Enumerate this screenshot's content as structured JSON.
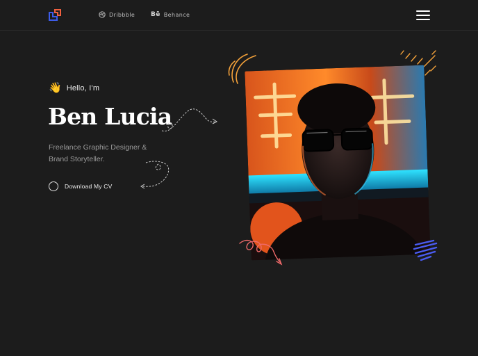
{
  "header": {
    "nav": [
      {
        "label": "Dribbble",
        "icon": "dribbble-icon"
      },
      {
        "label": "Behance",
        "icon": "behance-icon",
        "glyph": "Bē"
      }
    ],
    "menu_icon": "hamburger-menu-icon"
  },
  "hero": {
    "greeting": "Hello, I'm",
    "wave_emoji": "👋",
    "name": "Ben Lucia",
    "tagline": "Freelance Graphic Designer & Brand Storyteller.",
    "cta": "Download My CV"
  },
  "colors": {
    "background": "#1c1c1c",
    "logo_orange": "#f0603f",
    "logo_blue": "#3d5ce8",
    "accent_orange": "#f5a23a",
    "scribble_blue": "#4a5cf2",
    "swirl_pink": "#ef6a6a"
  }
}
